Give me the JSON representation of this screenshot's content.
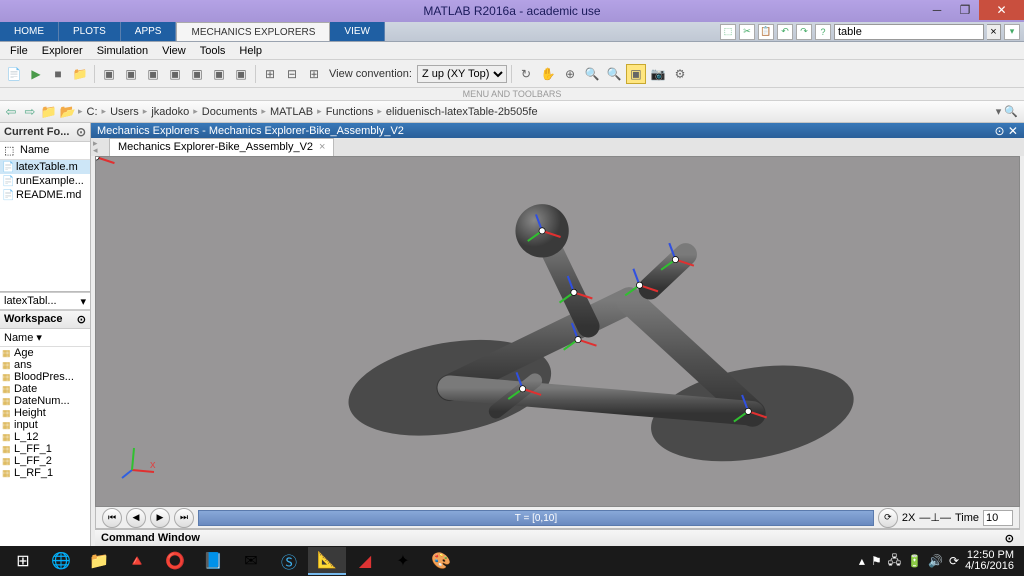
{
  "title": "MATLAB R2016a - academic use",
  "ribbon": {
    "tabs": [
      "HOME",
      "PLOTS",
      "APPS",
      "MECHANICS EXPLORERS",
      "VIEW"
    ],
    "search": "table"
  },
  "menubar": [
    "File",
    "Explorer",
    "Simulation",
    "View",
    "Tools",
    "Help"
  ],
  "toolbar": {
    "viewconv_label": "View convention:",
    "viewconv_value": "Z up (XY Top)"
  },
  "menu_toolbars_label": "MENU AND TOOLBARS",
  "breadcrumbs": [
    "C:",
    "Users",
    "jkadoko",
    "Documents",
    "MATLAB",
    "Functions",
    "eliduenisch-latexTable-2b505fe"
  ],
  "current_folder": {
    "title": "Current Fo...",
    "col": "Name",
    "files": [
      {
        "icon": "📄",
        "name": "latexTable.m",
        "sel": true
      },
      {
        "icon": "📄",
        "name": "runExample..."
      },
      {
        "icon": "📄",
        "name": "README.md"
      }
    ],
    "selector": "latexTabl..."
  },
  "workspace": {
    "title": "Workspace",
    "col": "Name ▾",
    "vars": [
      "Age",
      "ans",
      "BloodPres...",
      "Date",
      "DateNum...",
      "Height",
      "input",
      "L_12",
      "L_FF_1",
      "L_FF_2",
      "L_RF_1"
    ]
  },
  "explorer": {
    "header": "Mechanics Explorers - Mechanics Explorer-Bike_Assembly_V2",
    "tab": "Mechanics Explorer-Bike_Assembly_V2",
    "timeline": "T = [0,10]",
    "speed": "2X",
    "time_label": "Time",
    "time_value": "10"
  },
  "cmdwin": "Command Window",
  "tray": {
    "time": "12:50 PM",
    "date": "4/16/2016"
  }
}
